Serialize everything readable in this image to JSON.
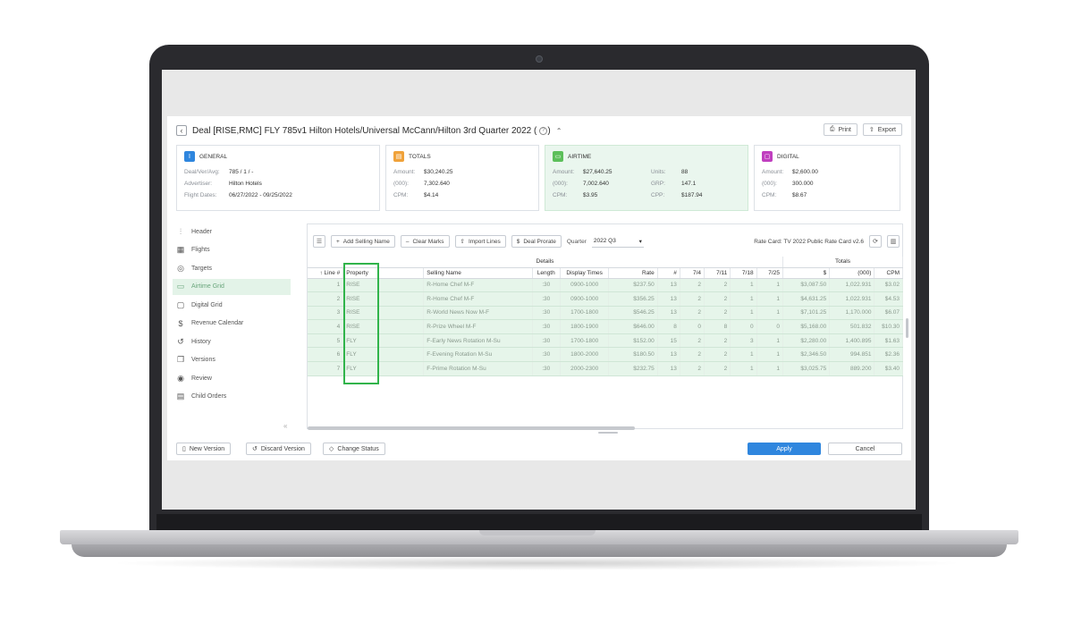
{
  "header": {
    "title": "Deal [RISE,RMC] FLY 785v1 Hilton Hotels/Universal McCann/Hilton 3rd Quarter 2022 (",
    "print_label": "Print",
    "export_label": "Export"
  },
  "cards": {
    "general": {
      "title": "GENERAL",
      "rows": [
        {
          "k": "Deal/Ver/Avg:",
          "v": "785 / 1 / -"
        },
        {
          "k": "Advertiser:",
          "v": "Hilton Hotels"
        },
        {
          "k": "Flight Dates:",
          "v": "06/27/2022 - 09/25/2022"
        }
      ]
    },
    "totals": {
      "title": "TOTALS",
      "rows": [
        {
          "k": "Amount:",
          "v": "$30,240.25"
        },
        {
          "k": "(000):",
          "v": "7,302.640"
        },
        {
          "k": "CPM:",
          "v": "$4.14"
        }
      ]
    },
    "airtime": {
      "title": "AIRTIME",
      "rows": [
        {
          "k": "Amount:",
          "v": "$27,640.25"
        },
        {
          "k": "Units:",
          "v": "88"
        },
        {
          "k": "(000):",
          "v": "7,002.640"
        },
        {
          "k": "GRP:",
          "v": "147.1"
        },
        {
          "k": "CPM:",
          "v": "$3.95"
        },
        {
          "k": "CPP:",
          "v": "$187.94"
        }
      ]
    },
    "digital": {
      "title": "DIGITAL",
      "rows": [
        {
          "k": "Amount:",
          "v": "$2,600.00"
        },
        {
          "k": "(000):",
          "v": "300.000"
        },
        {
          "k": "CPM:",
          "v": "$8.67"
        }
      ]
    }
  },
  "sidebar": {
    "items": [
      {
        "label": "Header",
        "icon": "bar-chart-icon"
      },
      {
        "label": "Flights",
        "icon": "calendar-icon"
      },
      {
        "label": "Targets",
        "icon": "target-icon"
      },
      {
        "label": "Airtime Grid",
        "icon": "tv-icon"
      },
      {
        "label": "Digital Grid",
        "icon": "monitor-icon"
      },
      {
        "label": "Revenue Calendar",
        "icon": "dollar-icon"
      },
      {
        "label": "History",
        "icon": "history-icon"
      },
      {
        "label": "Versions",
        "icon": "versions-icon"
      },
      {
        "label": "Review",
        "icon": "eye-icon"
      },
      {
        "label": "Child Orders",
        "icon": "document-icon"
      }
    ],
    "collapse": "«"
  },
  "toolbar": {
    "add_selling_name": "Add Selling Name",
    "clear_marks": "Clear Marks",
    "import_lines": "Import Lines",
    "deal_prorate": "Deal Prorate",
    "quarter_label": "Quarter",
    "quarter_value": "2022 Q3",
    "rate_card": "Rate Card: TV 2022 Public Rate Card v2.6"
  },
  "grid": {
    "group_details": "Details",
    "group_totals": "Totals",
    "columns": [
      "Line #",
      "Property",
      "Selling Name",
      "Length",
      "Display Times",
      "Rate",
      "#",
      "7/4",
      "7/11",
      "7/18",
      "7/25",
      "$",
      "(000)",
      "CPM"
    ],
    "rows": [
      [
        "1",
        "RISE",
        "R-Home Chef M-F",
        ":30",
        "0900-1000",
        "$237.50",
        "13",
        "2",
        "2",
        "1",
        "1",
        "$3,087.50",
        "1,022.931",
        "$3.02"
      ],
      [
        "2",
        "RISE",
        "R-Home Chef M-F",
        ":30",
        "0900-1000",
        "$356.25",
        "13",
        "2",
        "2",
        "1",
        "1",
        "$4,631.25",
        "1,022.931",
        "$4.53"
      ],
      [
        "3",
        "RISE",
        "R-World News Now M-F",
        ":30",
        "1700-1800",
        "$546.25",
        "13",
        "2",
        "2",
        "1",
        "1",
        "$7,101.25",
        "1,170.000",
        "$6.07"
      ],
      [
        "4",
        "RISE",
        "R-Prize Wheel M-F",
        ":30",
        "1800-1900",
        "$646.00",
        "8",
        "0",
        "8",
        "0",
        "0",
        "$5,168.00",
        "501.832",
        "$10.30"
      ],
      [
        "5",
        "FLY",
        "F-Early News Rotation M-Su",
        ":30",
        "1700-1800",
        "$152.00",
        "15",
        "2",
        "2",
        "3",
        "1",
        "$2,280.00",
        "1,400.895",
        "$1.63"
      ],
      [
        "6",
        "FLY",
        "F-Evening Rotation M-Su",
        ":30",
        "1800-2000",
        "$180.50",
        "13",
        "2",
        "2",
        "1",
        "1",
        "$2,346.50",
        "994.851",
        "$2.36"
      ],
      [
        "7",
        "FLY",
        "F-Prime Rotation M-Su",
        ":30",
        "2000-2300",
        "$232.75",
        "13",
        "2",
        "2",
        "1",
        "1",
        "$3,025.75",
        "889.200",
        "$3.40"
      ]
    ]
  },
  "footer": {
    "new_version": "New Version",
    "discard_version": "Discard Version",
    "change_status": "Change Status",
    "apply": "Apply",
    "cancel": "Cancel"
  },
  "colors": {
    "accent_blue": "#2f86de",
    "general_icon": "#2f86de",
    "totals_icon": "#f0a23a",
    "airtime_icon": "#5cbf5a",
    "digital_icon": "#c03fbf",
    "highlight_green": "#31b44b"
  }
}
